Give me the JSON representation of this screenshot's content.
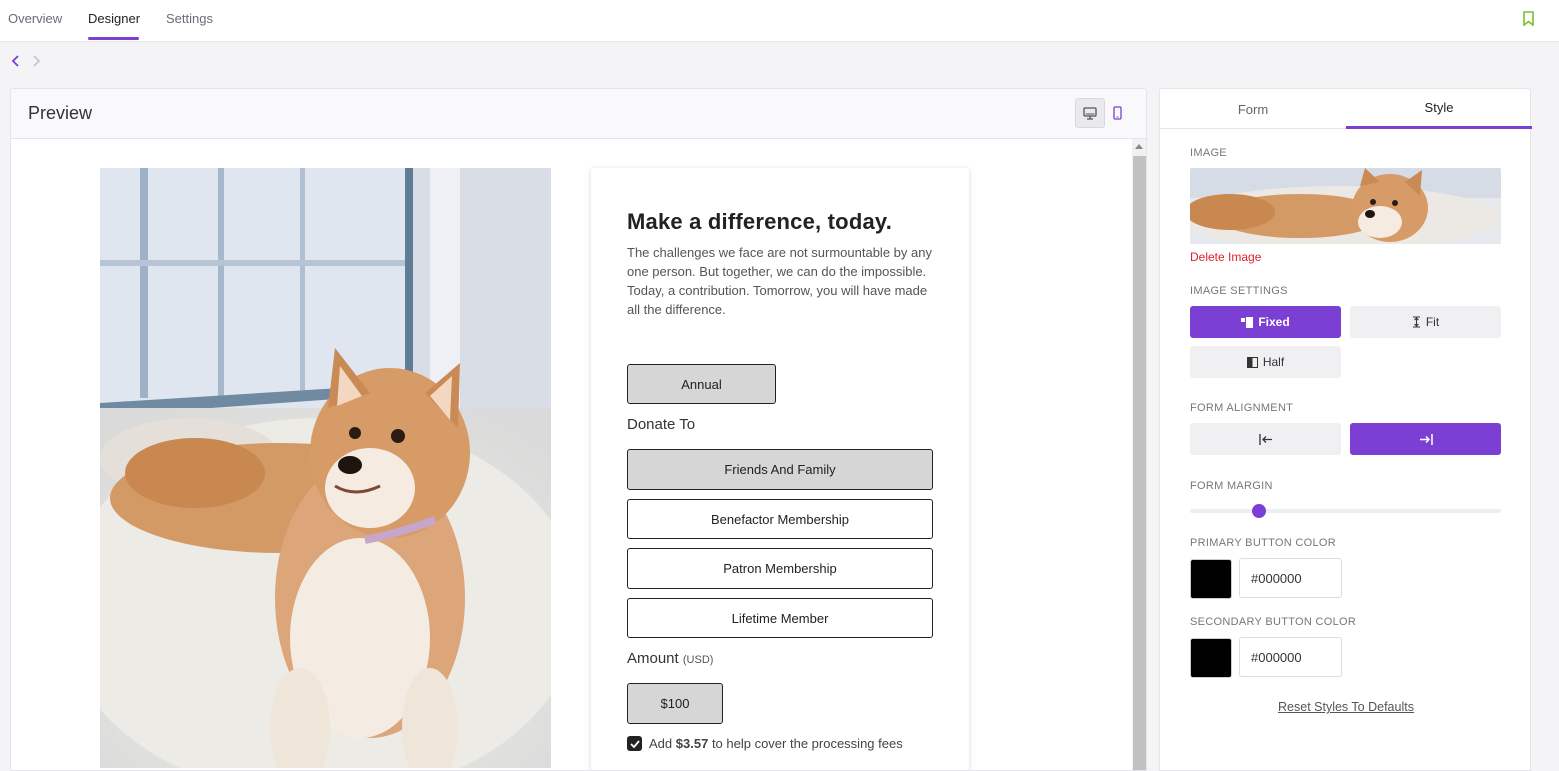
{
  "nav": {
    "tabs": [
      {
        "label": "Overview"
      },
      {
        "label": "Designer"
      },
      {
        "label": "Settings"
      }
    ],
    "active_tab": "Designer",
    "accent_color": "#7b3fd4",
    "bookmark_icon": "bookmark-icon"
  },
  "preview": {
    "title": "Preview",
    "devices": [
      "desktop-icon",
      "mobile-icon"
    ],
    "active_device": "desktop",
    "form": {
      "heading": "Make a difference, today.",
      "description": "The challenges we face are not surmountable by any one person. But together, we can do the impossible. Today, a contribution. Tomorrow, you will have made all the difference.",
      "frequency_button": "Annual",
      "donate_to_label": "Donate To",
      "designations": [
        {
          "label": "Friends And Family",
          "selected": true
        },
        {
          "label": "Benefactor Membership",
          "selected": false
        },
        {
          "label": "Patron Membership",
          "selected": false
        },
        {
          "label": "Lifetime Member",
          "selected": false
        }
      ],
      "amount_label": "Amount",
      "amount_currency": "(USD)",
      "amount_button": "$100",
      "fee": {
        "prefix": "Add",
        "amount": "$3.57",
        "suffix": "to help cover the processing fees",
        "checked": true
      }
    }
  },
  "side": {
    "tabs": [
      {
        "label": "Form"
      },
      {
        "label": "Style"
      }
    ],
    "active_tab": "Style",
    "image_heading": "IMAGE",
    "delete_image": "Delete Image",
    "image_settings_heading": "IMAGE SETTINGS",
    "image_settings": [
      {
        "label": "Fixed",
        "icon": "fixed-layout-icon",
        "active": true
      },
      {
        "label": "Fit",
        "icon": "fit-height-icon",
        "active": false
      },
      {
        "label": "Half",
        "icon": "half-layout-icon",
        "active": false
      }
    ],
    "form_alignment_heading": "FORM ALIGNMENT",
    "alignment": [
      {
        "icon": "align-left-icon",
        "active": false
      },
      {
        "icon": "align-right-icon",
        "active": true
      }
    ],
    "form_margin_heading": "FORM MARGIN",
    "form_margin_level": 0.21,
    "primary_color_heading": "PRIMARY BUTTON COLOR",
    "primary_color": "#000000",
    "secondary_color_heading": "SECONDARY BUTTON COLOR",
    "secondary_color": "#000000",
    "reset_label": "Reset Styles To Defaults"
  }
}
